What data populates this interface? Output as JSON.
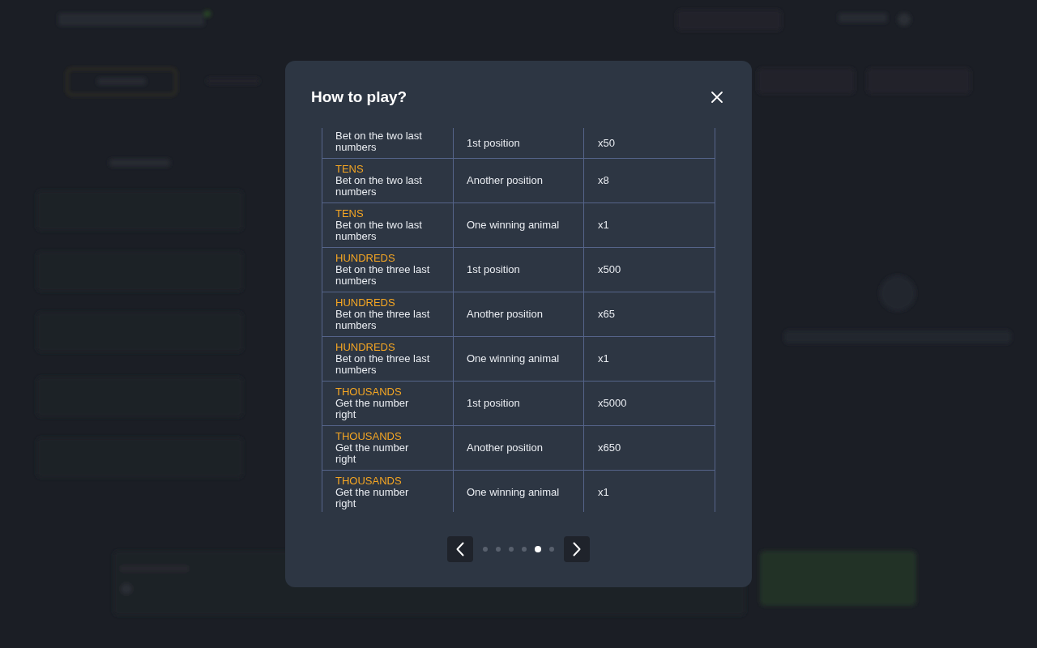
{
  "dialog": {
    "title": "How to play?",
    "rows": [
      {
        "description": "Bet on the two last numbers",
        "position": "1st position",
        "multiplier": "x50"
      },
      {
        "label": "TENS",
        "description": "Bet on the two last numbers",
        "position": "Another position",
        "multiplier": "x8"
      },
      {
        "label": "TENS",
        "description": "Bet on the two last numbers",
        "position": "One winning animal",
        "multiplier": "x1"
      },
      {
        "label": "HUNDREDS",
        "description": "Bet on the three last numbers",
        "position": "1st position",
        "multiplier": "x500"
      },
      {
        "label": "HUNDREDS",
        "description": "Bet on the three last numbers",
        "position": "Another position",
        "multiplier": "x65"
      },
      {
        "label": "HUNDREDS",
        "description": "Bet on the three last numbers",
        "position": "One winning animal",
        "multiplier": "x1"
      },
      {
        "label": "THOUSANDS",
        "description": "Get the number right",
        "position": "1st position",
        "multiplier": "x5000"
      },
      {
        "label": "THOUSANDS",
        "description": "Get the number right",
        "position": "Another position",
        "multiplier": "x650"
      },
      {
        "label": "THOUSANDS",
        "description": "Get the number right",
        "position": "One winning animal",
        "multiplier": "x1"
      }
    ]
  },
  "pagination": {
    "pages": [
      {
        "selected": false
      },
      {
        "selected": false
      },
      {
        "selected": false
      },
      {
        "selected": false
      },
      {
        "selected": true
      },
      {
        "selected": false
      }
    ]
  }
}
